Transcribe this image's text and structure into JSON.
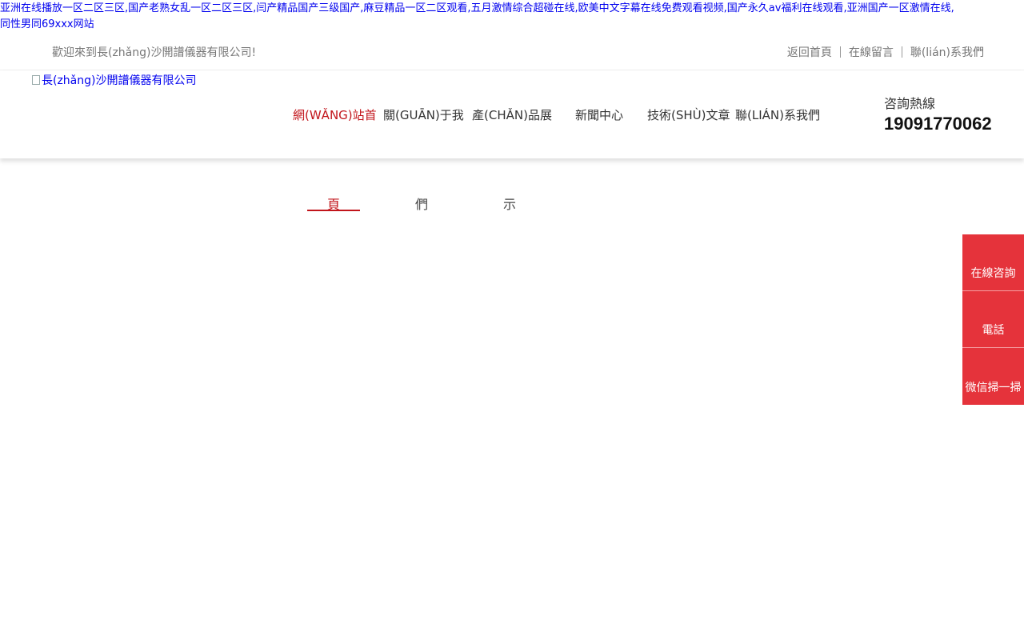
{
  "spam_links": {
    "line1": "亚洲在线播放一区二区三区,国产老熟女乱一区二区三区,闫产精品国产三级国产,麻豆精品一区二区观看,五月激情综合超碰在线,欧美中文字幕在线免费观看视频,国产永久av福利在线观看,亚洲国产一区激情在线,",
    "line2": "同性男同69xxx网站"
  },
  "topbar": {
    "welcome": "歡迎來到長(zhǎng)沙開譜儀器有限公司!",
    "links": [
      "返回首頁",
      "在線留言",
      "聯(lián)系我們"
    ]
  },
  "header": {
    "logo_alt": "長(zhǎng)沙開譜儀器有限公司",
    "nav": [
      "網(WǍNG)站首",
      "關(GUĀN)于我",
      "產(CHǍN)品展",
      "新聞中心",
      "技術(SHÙ)文章",
      "聯(LIÁN)系我們"
    ],
    "hotline_label": "咨詢熱線",
    "hotline_number": "19091770062"
  },
  "subtabs": [
    "頁",
    "們",
    "示"
  ],
  "float_panel": [
    "在線咨詢",
    "電話",
    "微信掃一掃"
  ],
  "colors": {
    "accent": "#c2151b",
    "float_bg": "#e5333b",
    "link_blue": "#0000ee"
  }
}
